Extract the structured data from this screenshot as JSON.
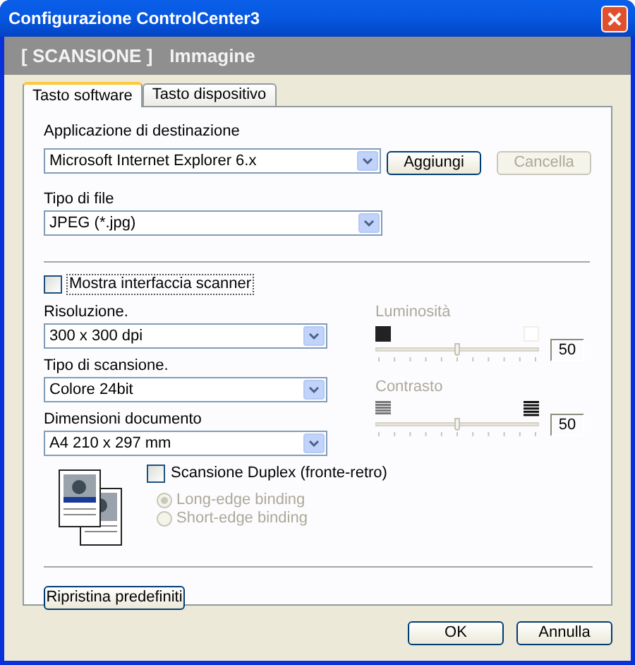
{
  "window": {
    "title": "Configurazione ControlCenter3"
  },
  "header": {
    "section": "[ SCANSIONE ]",
    "subsection": "Immagine"
  },
  "tabs": [
    {
      "label": "Tasto software",
      "selected": true
    },
    {
      "label": "Tasto dispositivo",
      "selected": false
    }
  ],
  "destination": {
    "label": "Applicazione di destinazione",
    "value": "Microsoft Internet Explorer 6.x",
    "buttons": [
      {
        "label": "Aggiungi",
        "disabled": false
      },
      {
        "label": "Cancella",
        "disabled": true
      }
    ]
  },
  "file_type": {
    "label": "Tipo di file",
    "value": "JPEG (*.jpg)"
  },
  "show_scanner_interface": {
    "label": "Mostra interfaccia scanner",
    "checked": false
  },
  "dropdowns": [
    {
      "label": "Risoluzione.",
      "value": "300 x 300 dpi"
    },
    {
      "label": "Tipo di scansione.",
      "value": "Colore 24bit"
    },
    {
      "label": "Dimensioni documento",
      "value": "A4 210 x 297 mm"
    }
  ],
  "sliders": [
    {
      "kind": "brightness",
      "label": "Luminosità",
      "disabled": true,
      "level": 0.5,
      "reading": "50"
    },
    {
      "kind": "contrast",
      "label": "Contrasto",
      "disabled": true,
      "level": 0.5,
      "reading": "50"
    }
  ],
  "duplex": {
    "label": "Scansione Duplex (fronte-retro)",
    "checked": false,
    "options": [
      {
        "label": "Long-edge binding",
        "selected": true,
        "disabled": true
      },
      {
        "label": "Short-edge binding",
        "selected": false,
        "disabled": true
      }
    ]
  },
  "reset_button": "Ripristina predefiniti",
  "buttons": [
    "OK",
    "Annulla"
  ]
}
